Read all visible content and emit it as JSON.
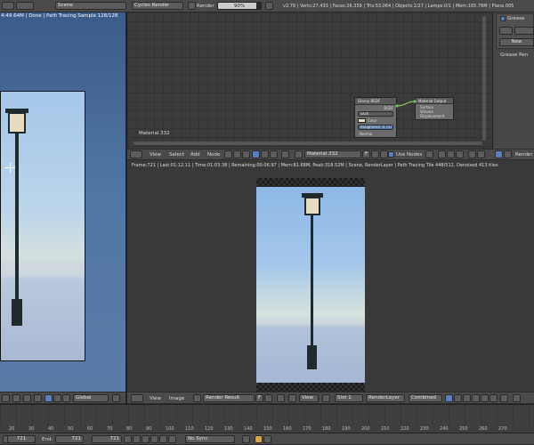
{
  "top_header": {
    "scene": "Scene",
    "engine": "Cycles Render",
    "render_label": "Render",
    "progress_text": "90%",
    "progress_fraction": 0.9,
    "stats": "v2.79 | Verts:27,433 | Faces:26,358 | Tris:53,064 | Objects:1/27 | Lamps:0/1 | Mem:165.76M | Plane.005"
  },
  "viewport": {
    "status": "4:49.64M | Done | Path Tracing Sample 128/128",
    "orientation": "Global"
  },
  "node_editor": {
    "material_label": "Material.332",
    "node1_title": "Glossy BSDF",
    "node1_rows": [
      "BSDF",
      "GGX",
      "Color",
      "Roughness: 0.717",
      "Normal"
    ],
    "node2_title": "Material Output",
    "node2_rows": [
      "Surface",
      "Volume",
      "Displacement"
    ],
    "header_menus": [
      "View",
      "Select",
      "Add",
      "Node"
    ],
    "material_field": "Material.332",
    "use_nodes": "Use Nodes"
  },
  "properties_panel": {
    "grease_label": "Grease",
    "new_button": "New",
    "grease_pencil_label": "Grease Pen"
  },
  "image_editor": {
    "info": "Frame:721 | Last:01:12.11 | Time:01:03.38 | Remaining:00:06.97 | Mem:81.68M, Peak:318.52M | Scene, RenderLayer | Path Tracing Tile 448/512, Denoised 413 tiles",
    "menus": [
      "View",
      "Image"
    ],
    "image_name": "Render Result",
    "view_select": "View",
    "slot": "Slot 1",
    "layer": "RenderLayer",
    "pass": "Combined",
    "render_corner": "Render"
  },
  "timeline": {
    "ticks": [
      "20",
      "30",
      "40",
      "50",
      "60",
      "70",
      "80",
      "90",
      "100",
      "110",
      "120",
      "130",
      "140",
      "150",
      "160",
      "170",
      "180",
      "190",
      "200",
      "210",
      "220",
      "230",
      "240",
      "250",
      "260",
      "270"
    ],
    "start_value": "721",
    "end_label": "End:",
    "end_value": "721",
    "current": "721",
    "sync": "No Sync"
  },
  "colors": {
    "accent": "#5680c2",
    "panel_bg": "#393939",
    "header_bg": "#4a4a4a"
  }
}
